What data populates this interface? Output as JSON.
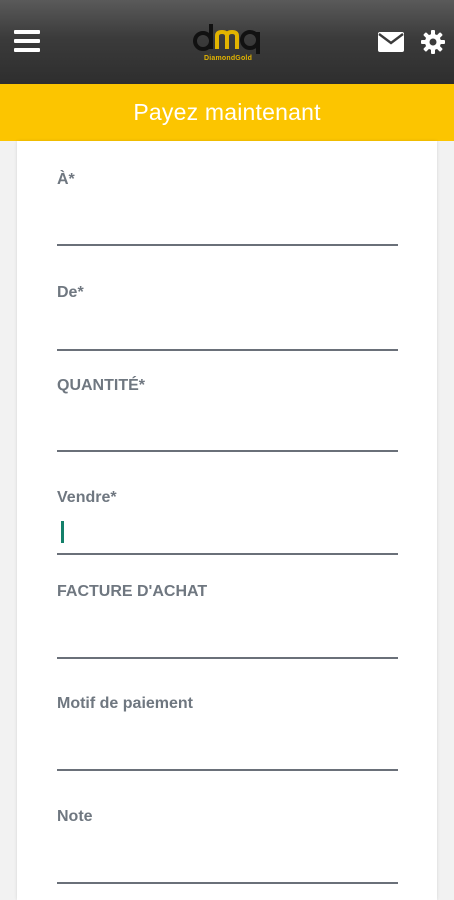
{
  "app": {
    "logo_mark": "dmq",
    "logo_text": "DiamondGold"
  },
  "header": {
    "title": "Payez maintenant"
  },
  "icons": {
    "menu": "menu-icon",
    "mail": "mail-icon",
    "settings": "gear-icon"
  },
  "colors": {
    "accent": "#fcc500",
    "topbar": "#3b3b3b",
    "label": "#6f7780",
    "cursor": "#14806a"
  },
  "form": {
    "fields": [
      {
        "label": "À*",
        "value": ""
      },
      {
        "label": "De*",
        "value": ""
      },
      {
        "label": "QUANTITÉ*",
        "value": ""
      },
      {
        "label": "Vendre*",
        "value": ""
      },
      {
        "label": "FACTURE D'ACHAT",
        "value": ""
      },
      {
        "label": "Motif de paiement",
        "value": ""
      },
      {
        "label": "Note",
        "value": ""
      }
    ]
  }
}
